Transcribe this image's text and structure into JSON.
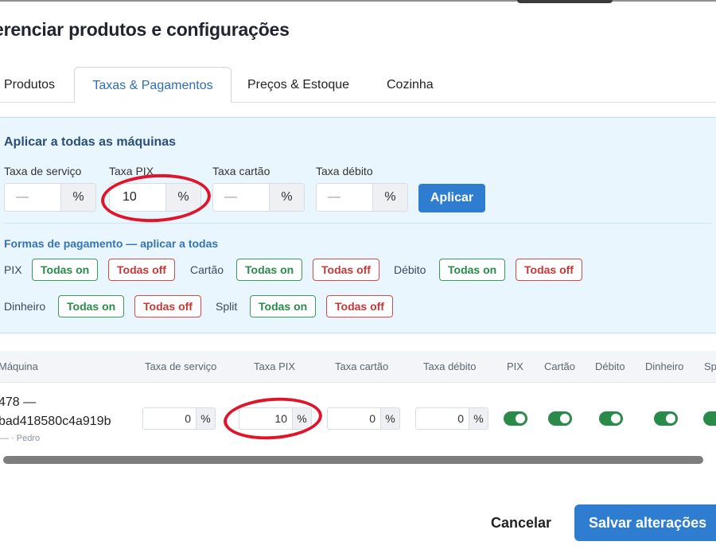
{
  "title": "erenciar produtos e configurações",
  "tabs": [
    {
      "label": "Produtos",
      "active": false
    },
    {
      "label": "Taxas & Pagamentos",
      "active": true
    },
    {
      "label": "Preços & Estoque",
      "active": false
    },
    {
      "label": "Cozinha",
      "active": false
    }
  ],
  "apply_all": {
    "title": "Aplicar a todas as máquinas",
    "fields": [
      {
        "label": "Taxa de serviço",
        "value": "—",
        "unit": "%"
      },
      {
        "label": "Taxa PIX",
        "value": "10",
        "unit": "%"
      },
      {
        "label": "Taxa cartão",
        "value": "—",
        "unit": "%"
      },
      {
        "label": "Taxa débito",
        "value": "—",
        "unit": "%"
      }
    ],
    "apply_label": "Aplicar"
  },
  "payment_methods": {
    "title": "Formas de pagamento — aplicar a todas",
    "on_label": "Todas on",
    "off_label": "Todas off",
    "methods": [
      "PIX",
      "Cartão",
      "Débito",
      "Dinheiro",
      "Split"
    ]
  },
  "table": {
    "headers": [
      "Máquina",
      "Taxa de serviço",
      "Taxa PIX",
      "Taxa cartão",
      "Taxa débito",
      "PIX",
      "Cartão",
      "Débito",
      "Dinheiro",
      "Sp"
    ],
    "rows": [
      {
        "machine_line1": "478 —",
        "machine_line2": "bad418580c4a919b",
        "machine_sub": "— · Pedro",
        "taxa_servico": "0",
        "taxa_pix": "10",
        "taxa_cartao": "0",
        "taxa_debito": "0",
        "unit": "%",
        "toggles": {
          "pix": true,
          "cartao": true,
          "debito": true,
          "dinheiro": true,
          "split": true
        }
      }
    ]
  },
  "footer": {
    "cancel_label": "Cancelar",
    "save_label": "Salvar alterações"
  },
  "colors": {
    "accent": "#2f7dd1",
    "panel_bg": "#eaf6fd",
    "on": "#2a8a4a",
    "off": "#c63838",
    "annotation": "#e0142a"
  }
}
